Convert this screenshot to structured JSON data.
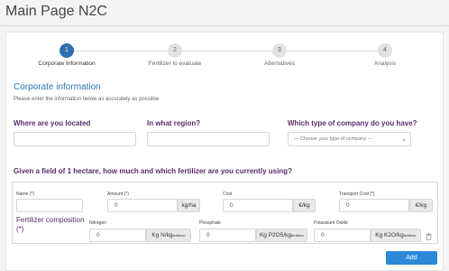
{
  "page": {
    "title": "Main Page N2C"
  },
  "wizard": {
    "steps": [
      {
        "number": "1",
        "label": "Corporate Information",
        "active": true
      },
      {
        "number": "2",
        "label": "Fertilizer to evaluate",
        "active": false
      },
      {
        "number": "3",
        "label": "Alternatives",
        "active": false
      },
      {
        "number": "4",
        "label": "Analysis",
        "active": false
      }
    ]
  },
  "section": {
    "title": "Corporate information",
    "subtitle": "Please enter the information below as accurately as possible"
  },
  "questions": {
    "location": {
      "label": "Where are you located",
      "value": ""
    },
    "region": {
      "label": "In what region?",
      "value": ""
    },
    "company_type": {
      "label": "Which type of company do you have?",
      "placeholder": "--- Choose your type of company ---"
    }
  },
  "fertilizer": {
    "question": "Given a field of 1 hectare, how much and which fertilizer are you currently using?",
    "name": {
      "label": "Name (*)",
      "value": ""
    },
    "amount": {
      "label": "Amount (*)",
      "value": "0",
      "unit": "kg/ha"
    },
    "cost": {
      "label": "Cost",
      "value": "0",
      "unit": "€/kg"
    },
    "transport_cost": {
      "label": "Transport Cost (*)",
      "value": "0",
      "unit": "€/kg"
    },
    "composition_label": "Fertilizer composition (*)",
    "nitrogen": {
      "label": "Nitrogen",
      "value": "0",
      "unit_main": "Kg N/kg",
      "unit_sub": "fertilizer"
    },
    "phosphate": {
      "label": "Phosphate",
      "value": "0",
      "unit_main": "Kg P2O5/kg",
      "unit_sub": "fertilizer"
    },
    "potassium": {
      "label": "Potassium Oxide",
      "value": "0",
      "unit_main": "Kg K2O/kg",
      "unit_sub": "fertilizer"
    }
  },
  "actions": {
    "add_label": "Add"
  },
  "icons": {
    "delete": "trash-icon",
    "dropdown": "chevron-down-icon"
  },
  "colors": {
    "accent": "#2c6fae",
    "question": "#5b2b6b",
    "button": "#2c88d9"
  }
}
